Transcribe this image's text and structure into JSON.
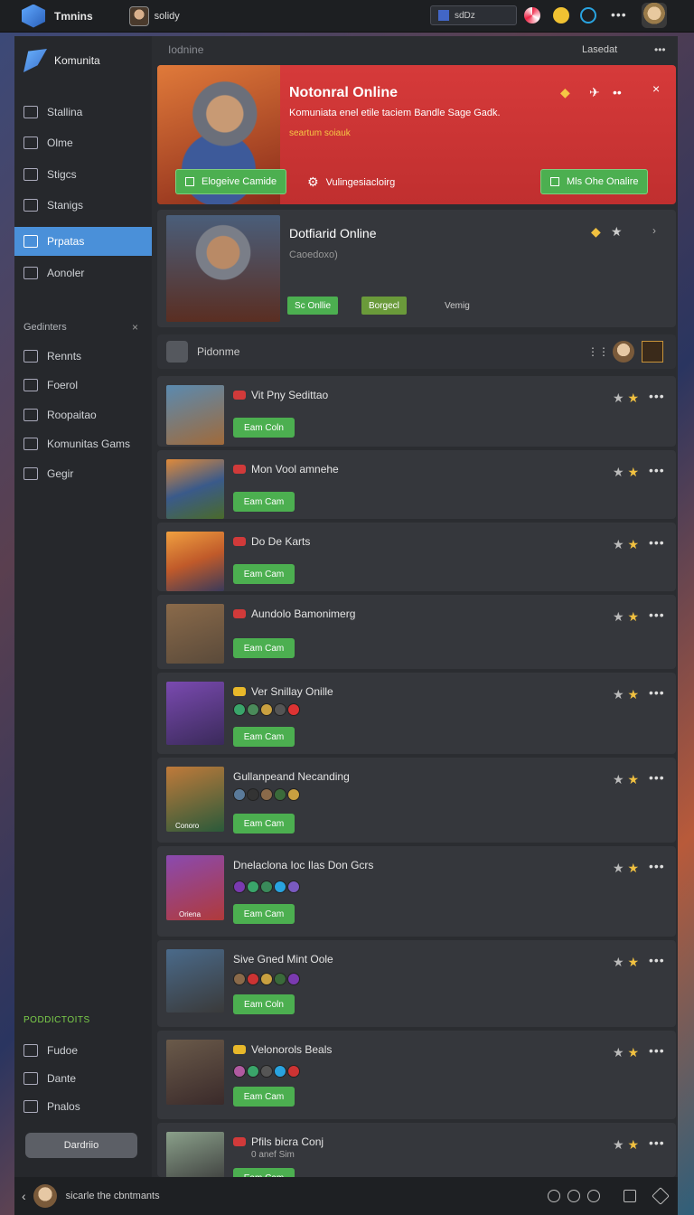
{
  "topbar": {
    "app_title": "Tmnins",
    "user_name": "solidy",
    "search_text": "sdDz",
    "more": "•••",
    "icons": [
      "app-logo-icon",
      "user-avatar",
      "search-icon",
      "notification-icon",
      "coin-icon",
      "cloud-icon",
      "profile-avatar"
    ]
  },
  "sidebar": {
    "brand": "Komunita",
    "items": [
      {
        "label": "Stallina",
        "icon": "chat-icon"
      },
      {
        "label": "Olme",
        "icon": "monitor-icon"
      },
      {
        "label": "Stigcs",
        "icon": "list-icon"
      },
      {
        "label": "Stanigs",
        "icon": "settings-icon"
      },
      {
        "label": "Prpatas",
        "icon": "home-icon",
        "active": true
      },
      {
        "label": "Aonoler",
        "icon": "user-icon"
      }
    ],
    "section_title": "Gedinters",
    "section_close": "×",
    "section_items": [
      {
        "label": "Rennts",
        "icon": "send-icon"
      },
      {
        "label": "Foerol",
        "icon": "flag-icon"
      },
      {
        "label": "Roopaitao",
        "icon": "gear-icon"
      },
      {
        "label": "Komunitas Gams",
        "icon": "image-icon"
      },
      {
        "label": "Gegir",
        "icon": "clock-icon"
      }
    ],
    "green_heading": "PODDICTOITS",
    "bottom_items": [
      {
        "label": "Fudoe",
        "icon": "refresh-icon"
      },
      {
        "label": "Dante",
        "icon": "target-icon"
      },
      {
        "label": "Pnalos",
        "icon": "group-icon"
      }
    ],
    "button_label": "Dardriio"
  },
  "main": {
    "header_title": "Iodnine",
    "header_search": "Lasedat",
    "header_more": "•••",
    "hero": {
      "title": "Notonral Online",
      "subtitle": "Komuniata enel etile taciem Bandle Sage Gadk.",
      "meta": "seartum soiauk",
      "primary_button": "Elogeive Camide",
      "link": "Vulingesiacloirg",
      "secondary_button": "Mls Ohe Onalire",
      "close": "×",
      "accent": "#d63a3a"
    },
    "featured": {
      "title": "Dotfiarid Online",
      "subtitle": "Caoedoxo)",
      "tag1": "Sc Onllie",
      "tag2": "Borgecl",
      "tag3": "Vemig"
    },
    "list_title": "Pidonme",
    "rows": [
      {
        "name": "Vit Pny Sedittao",
        "button": "Eam Coln"
      },
      {
        "name": "Mon Vool amnehe",
        "button": "Eam Cam"
      },
      {
        "name": "Do De Karts",
        "button": "Eam Cam"
      },
      {
        "name": "Aundolo Bamonimerg",
        "button": "Eam Cam"
      },
      {
        "name": "Ver Snillay Onille",
        "button": "Eam Cam"
      },
      {
        "name": "Gullanpeand Necanding",
        "button": "Eam Cam"
      },
      {
        "name": "Dnelaclona Ioc Ilas Don Gcrs",
        "button": "Eam Cam"
      },
      {
        "name": "Sive Gned Mint Oole",
        "button": "Eam Coln"
      },
      {
        "name": "Velonorols Beals",
        "button": "Eam Cam"
      },
      {
        "name": "Pfils bicra Conj",
        "sub": "0 anef Sim",
        "button": "Eam Cam"
      }
    ],
    "thumb_labels": {
      "row6": "Conoro",
      "row7": "Oriena"
    }
  },
  "bottombar": {
    "text": "sicarle the cbntmants",
    "icons": [
      "globe-icon",
      "compass-icon",
      "gamepad-icon",
      "window-icon",
      "heart-icon"
    ]
  }
}
